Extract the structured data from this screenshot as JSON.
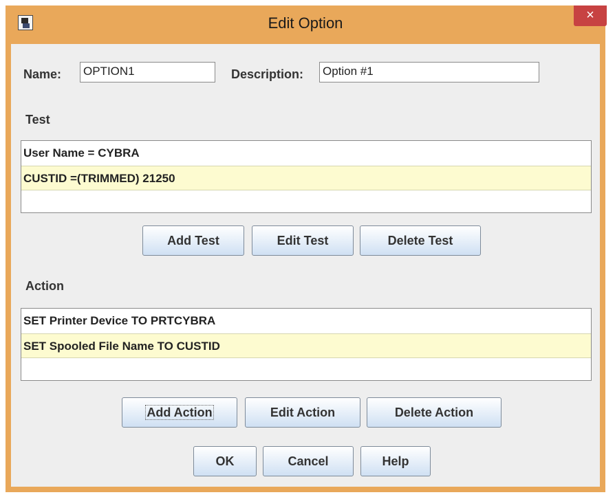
{
  "window": {
    "title": "Edit Option",
    "close_glyph": "×",
    "app_icon": "app-icon"
  },
  "fields": {
    "name_label": "Name:",
    "name_value": "OPTION1",
    "description_label": "Description:",
    "description_value": "Option #1"
  },
  "test": {
    "heading": "Test",
    "items": [
      {
        "text": "User Name = CYBRA",
        "selected": false
      },
      {
        "text": "CUSTID =(TRIMMED) 21250",
        "selected": true
      }
    ],
    "buttons": {
      "add": "Add Test",
      "edit": "Edit Test",
      "delete": "Delete Test"
    }
  },
  "action": {
    "heading": "Action",
    "items": [
      {
        "text": "SET Printer Device TO PRTCYBRA",
        "selected": false
      },
      {
        "text": "SET Spooled File Name TO CUSTID",
        "selected": true
      }
    ],
    "buttons": {
      "add": "Add Action",
      "edit": "Edit Action",
      "delete": "Delete Action"
    }
  },
  "dialog_buttons": {
    "ok": "OK",
    "cancel": "Cancel",
    "help": "Help"
  },
  "colors": {
    "frame": "#e9a85a",
    "close": "#c74242",
    "selection": "#fdfbd0"
  }
}
